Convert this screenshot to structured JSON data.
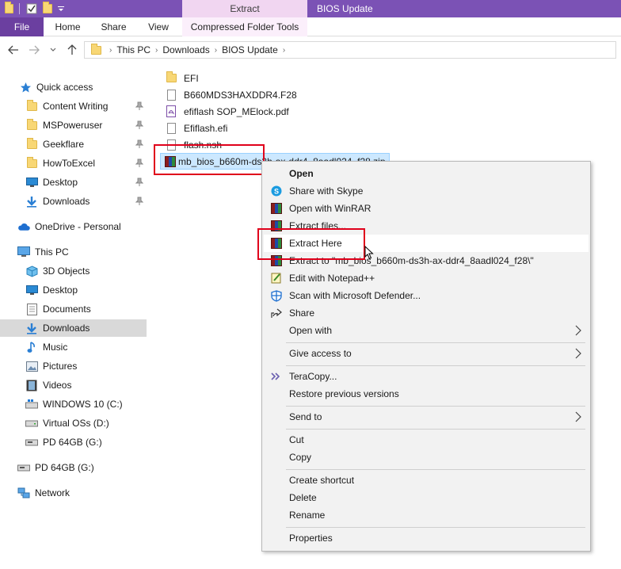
{
  "window": {
    "title": "BIOS Update",
    "context_tab_group": "Extract"
  },
  "ribbon": {
    "tabs": [
      {
        "label": "File"
      },
      {
        "label": "Home"
      },
      {
        "label": "Share"
      },
      {
        "label": "View"
      },
      {
        "label": "Compressed Folder Tools"
      }
    ]
  },
  "address": {
    "breadcrumbs": [
      "This PC",
      "Downloads",
      "BIOS Update"
    ]
  },
  "navpane": {
    "quick_access": "Quick access",
    "quick_items": [
      "Content Writing",
      "MSPoweruser",
      "Geekflare",
      "HowToExcel",
      "Desktop",
      "Downloads"
    ],
    "onedrive": "OneDrive - Personal",
    "this_pc": "This PC",
    "pc_items": [
      "3D Objects",
      "Desktop",
      "Documents",
      "Downloads",
      "Music",
      "Pictures",
      "Videos",
      "WINDOWS 10 (C:)",
      "Virtual OSs (D:)",
      "PD 64GB (G:)"
    ],
    "removable": "PD 64GB (G:)",
    "network": "Network",
    "selected": "Downloads"
  },
  "files": [
    {
      "name": "EFI",
      "icon": "folder-icon"
    },
    {
      "name": "B660MDS3HAXDDR4.F28",
      "icon": "file-icon"
    },
    {
      "name": "efiflash SOP_MElock.pdf",
      "icon": "pdf-icon"
    },
    {
      "name": "Efiflash.efi",
      "icon": "file-icon"
    },
    {
      "name": "flash.nsh",
      "icon": "file-icon"
    },
    {
      "name": "mb_bios_b660m-ds3h-ax-ddr4_8aadl024_f28.zip",
      "icon": "winrar-icon",
      "selected": true
    }
  ],
  "context_menu": {
    "open": "Open",
    "share_skype": "Share with Skype",
    "open_winrar": "Open with WinRAR",
    "extract_files": "Extract files...",
    "extract_here": "Extract Here",
    "extract_to": "Extract to \"mb_bios_b660m-ds3h-ax-ddr4_8aadl024_f28\\\"",
    "edit_notepad": "Edit with Notepad++",
    "scan_defender": "Scan with Microsoft Defender...",
    "share": "Share",
    "open_with": "Open with",
    "give_access": "Give access to",
    "teracopy": "TeraCopy...",
    "restore": "Restore previous versions",
    "send_to": "Send to",
    "cut": "Cut",
    "copy": "Copy",
    "create_shortcut": "Create shortcut",
    "delete": "Delete",
    "rename": "Rename",
    "properties": "Properties"
  },
  "colors": {
    "title_bar": "#7b52b5",
    "file_tab": "#6b3fa0",
    "context_tab": "#f1d6f1",
    "highlight_box": "#e0001b",
    "selection": "#cce8ff"
  }
}
